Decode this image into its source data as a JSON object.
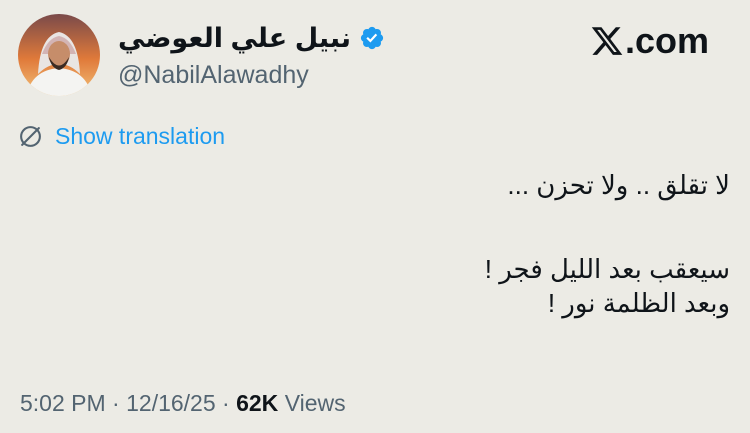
{
  "author": {
    "display_name": "نبيل علي العوضي",
    "handle": "@NabilAlawadhy",
    "verified_icon": "verified-badge-icon",
    "avatar_icon": "profile-photo"
  },
  "brand": {
    "label": ".com",
    "icon": "x-logo-icon"
  },
  "translate": {
    "label": "Show translation",
    "icon": "globe-icon"
  },
  "tweet": {
    "line1": "لا تقلق .. ولا تحزن ...",
    "line2": "سيعقب بعد الليل فجر !",
    "line3": "وبعد الظلمة نور !"
  },
  "meta": {
    "time": "5:02 PM",
    "separator": "·",
    "date": "12/16/25",
    "views_count": "62K",
    "views_label": "Views"
  },
  "colors": {
    "background": "#ecebe5",
    "text": "#0f1419",
    "secondary": "#536471",
    "accent": "#1d9bf0"
  }
}
